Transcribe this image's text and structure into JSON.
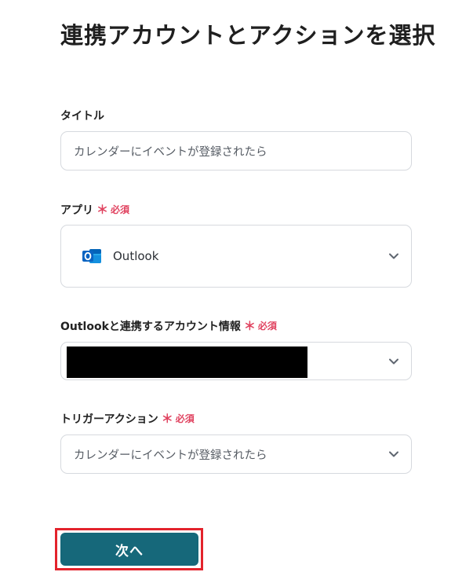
{
  "page": {
    "title": "連携アカウントとアクションを選択"
  },
  "required_label": {
    "star": "＊",
    "text": "必須"
  },
  "fields": {
    "title": {
      "label": "タイトル",
      "value": "カレンダーにイベントが登録されたら"
    },
    "app": {
      "label": "アプリ",
      "value": "Outlook",
      "icon": "outlook-icon"
    },
    "account": {
      "label": "Outlookと連携するアカウント情報",
      "value": ""
    },
    "trigger_action": {
      "label": "トリガーアクション",
      "value": "カレンダーにイベントが登録されたら"
    }
  },
  "buttons": {
    "next_label": "次へ"
  },
  "colors": {
    "accent": "#16687a",
    "required": "#e0425f",
    "highlight": "#e3232c",
    "outlook_blue": "#0a64c2"
  }
}
